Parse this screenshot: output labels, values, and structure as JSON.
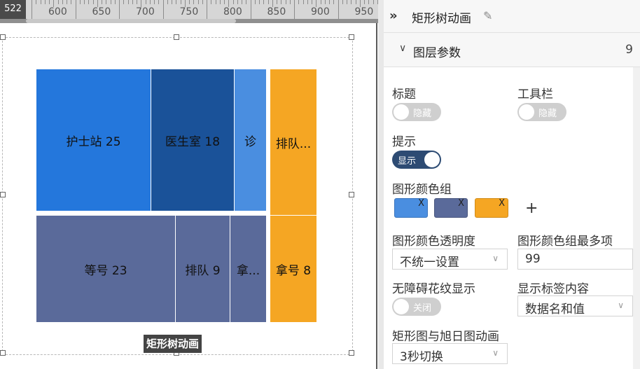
{
  "ruler": {
    "corner": "522",
    "ticks": [
      "600",
      "650",
      "700",
      "750",
      "800",
      "850",
      "900",
      "950"
    ]
  },
  "treemap": {
    "title": "矩形树动画",
    "tiles": [
      {
        "label": "护士站 25",
        "value": 25,
        "color": "#2477dc"
      },
      {
        "label": "医生室 18",
        "value": 18,
        "color": "#1a5299"
      },
      {
        "label": "诊",
        "color": "#4a8ee0"
      },
      {
        "label": "排队...",
        "color": "#f5a623"
      },
      {
        "label": "等号 23",
        "value": 23,
        "color": "#5a6a9a"
      },
      {
        "label": "排队 9",
        "value": 9,
        "color": "#5a6a9a"
      },
      {
        "label": "拿...",
        "color": "#5a6a9a"
      },
      {
        "label": "拿号 8",
        "value": 8,
        "color": "#f5a623"
      }
    ]
  },
  "panel": {
    "title": "矩形树动画",
    "edit_icon": "pencil-icon",
    "collapse_icon": "double-chevron-right-icon",
    "section": {
      "title": "图层参数",
      "count": "9"
    },
    "fields": {
      "title_label": "标题",
      "title_toggle": "隐藏",
      "toolbar_label": "工具栏",
      "toolbar_toggle": "隐藏",
      "tooltip_label": "提示",
      "tooltip_toggle": "显示",
      "color_group_label": "图形颜色组",
      "colors": [
        "#4a8ee0",
        "#5a6a9a",
        "#f5a623"
      ],
      "color_remove": "X",
      "add_color": "+",
      "opacity_label": "图形颜色透明度",
      "opacity_value": "不统一设置",
      "max_colors_label": "图形颜色组最多项",
      "max_colors_value": "99",
      "pattern_label": "无障碍花纹显示",
      "pattern_toggle": "关闭",
      "label_content_label": "显示标签内容",
      "label_content_value": "数据名和值",
      "anim_label": "矩形图与旭日图动画",
      "anim_value": "3秒切换"
    }
  }
}
